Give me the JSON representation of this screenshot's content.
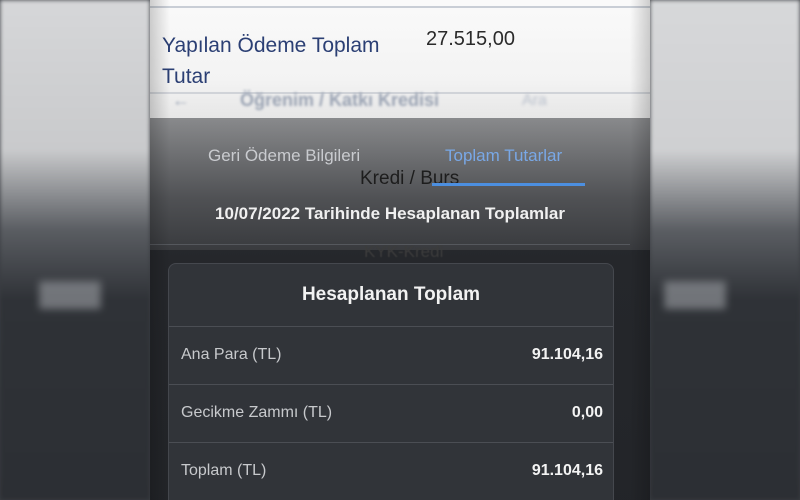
{
  "background_page": {
    "payment_label": "Yapılan Ödeme Toplam Tutar",
    "payment_value": "27.515,00",
    "behind_title": "Öğrenim / Katkı Kredisi",
    "behind_right": "Ara",
    "loan_type": "Kredi / Burs",
    "loan_value": "KYK-Kredi"
  },
  "tabs": [
    {
      "label": "Geri Ödeme Bilgileri"
    },
    {
      "label": "Toplam Tutarlar"
    }
  ],
  "header": {
    "date_title": "10/07/2022 Tarihinde Hesaplanan Toplamlar"
  },
  "card": {
    "title": "Hesaplanan Toplam",
    "rows": [
      {
        "label": "Ana Para (TL)",
        "value": "91.104,16"
      },
      {
        "label": "Gecikme Zammı (TL)",
        "value": "0,00"
      },
      {
        "label": "Toplam (TL)",
        "value": "91.104,16"
      }
    ]
  },
  "colors": {
    "active_tab": "#79a8e6",
    "tab_underline": "#4c8fe0",
    "label_navy": "#2b3f74"
  }
}
